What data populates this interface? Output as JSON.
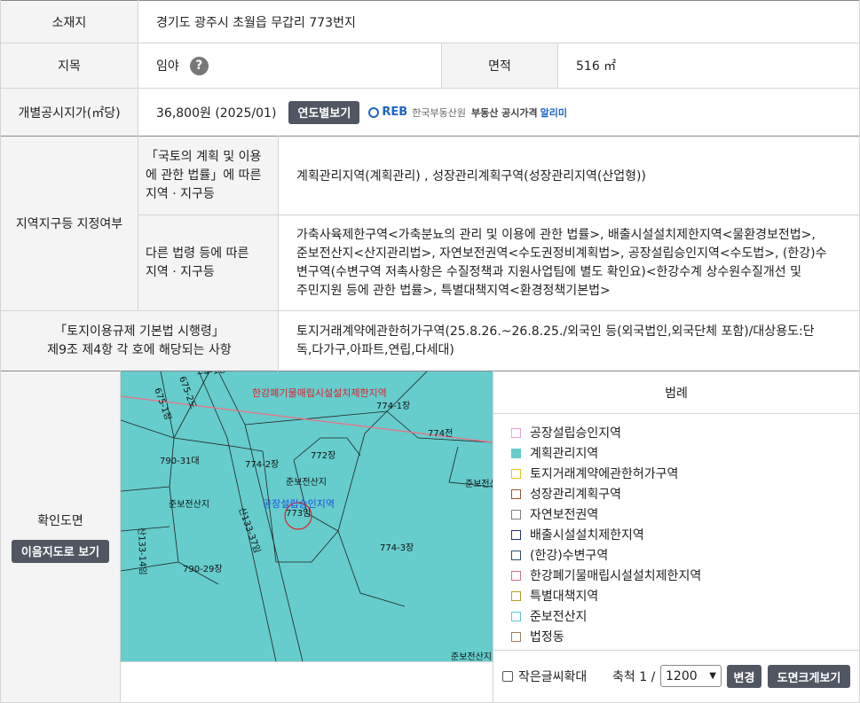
{
  "location": {
    "label": "소재지",
    "value": "경기도 광주시 초월읍 무갑리 773번지"
  },
  "land_category": {
    "label": "지목",
    "value": "임야",
    "help": "?"
  },
  "area": {
    "label": "면적",
    "value": "516 ㎡"
  },
  "official_price": {
    "label": "개별공시지가(㎡당)",
    "value": "36,800원 (2025/01)",
    "yearly_button": "연도별보기",
    "reb_logo": "REB",
    "reb_org": "한국부동산원",
    "reb_service": "부동산 공시가격",
    "reb_service_accent": "알리미"
  },
  "zoning": {
    "label": "지역지구등 지정여부",
    "national": {
      "sublabel_lines": [
        "「국토의 계획 및 이용",
        "에 관한 법률」에 따른",
        "지역 · 지구등"
      ],
      "value": "계획관리지역(계획관리) , 성장관리계획구역(성장관리지역(산업형))"
    },
    "other": {
      "sublabel_lines": [
        "다른 법령 등에 따른",
        "지역 · 지구등"
      ],
      "value_lines": [
        "가축사육제한구역<가축분뇨의 관리 및 이용에 관한 법률>, 배출시설설치제한지역<물환경보전법>,",
        "준보전산지<산지관리법>, 자연보전권역<수도권정비계획법>, 공장설립승인지역<수도법>, (한강)수",
        "변구역(수변구역 저촉사항은 수질정책과 지원사업팀에 별도 확인요)<한강수계 상수원수질개선 및",
        "주민지원 등에 관한 법률>, 특별대책지역<환경정책기본법>"
      ]
    }
  },
  "enforcement": {
    "label_lines": [
      "「토지이용규제 기본법 시행령」",
      "제9조 제4항 각 호에 해당되는 사항"
    ],
    "value_lines": [
      "토지거래계약에관한허가구역(25.8.26.~26.8.25./외국인 등(외국법인,외국단체 포함)/대상용도:단",
      "독,다가구,아파트,연립,다세대)"
    ]
  },
  "map_section": {
    "label": "확인도면",
    "view_button": "이음지도로 보기",
    "map_labels": {
      "restriction_zone": "한강폐기물매립시설설치제한지역",
      "factory_zone": "공장설립승인지역",
      "p773": "773임",
      "p774_1": "774-1장",
      "p774": "774전",
      "p774_2": "774-2장",
      "p772": "772장",
      "p774_3": "774-3장",
      "p790_31": "790-31대",
      "p790_29": "790-29장",
      "jb1": "준보전산지",
      "jb2": "준보전산지",
      "jb3": "준보전산지",
      "jb4": "준보전산지",
      "mt133_37": "산133-37임",
      "mt133_14": "산133-14임",
      "p675_2": "675-2도",
      "p675_1": "675-1장",
      "p_small": "~4-1장"
    },
    "colors": {
      "map_fill": "#66cccc",
      "restriction_line": "#f07080",
      "restriction_text": "#e0202a",
      "factory_text": "#2050e0",
      "highlight": "#e02020"
    }
  },
  "legend": {
    "title": "범례",
    "items": [
      {
        "label": "공장설립승인지역",
        "color": "#e8a0d8",
        "fill": false
      },
      {
        "label": "계획관리지역",
        "color": "#66cccc",
        "fill": true
      },
      {
        "label": "토지거래계약에관한허가구역",
        "color": "#e6c020",
        "fill": false
      },
      {
        "label": "성장관리계획구역",
        "color": "#a0522d",
        "fill": false
      },
      {
        "label": "자연보전권역",
        "color": "#808080",
        "fill": false
      },
      {
        "label": "배출시설설치제한지역",
        "color": "#20308a",
        "fill": false
      },
      {
        "label": "(한강)수변구역",
        "color": "#2f4f6f",
        "fill": false
      },
      {
        "label": "한강폐기물매립시설설치제한지역",
        "color": "#e07080",
        "fill": false
      },
      {
        "label": "특별대책지역",
        "color": "#b0a020",
        "fill": false
      },
      {
        "label": "준보전산지",
        "color": "#60c8c8",
        "fill": false
      },
      {
        "label": "법정동",
        "color": "#a08060",
        "fill": false
      }
    ]
  },
  "controls": {
    "small_text_zoom": "작은글씨확대",
    "scale_label": "축척 1 /",
    "scale_value": "1200",
    "change_button": "변경",
    "enlarge_button": "도면크게보기"
  }
}
